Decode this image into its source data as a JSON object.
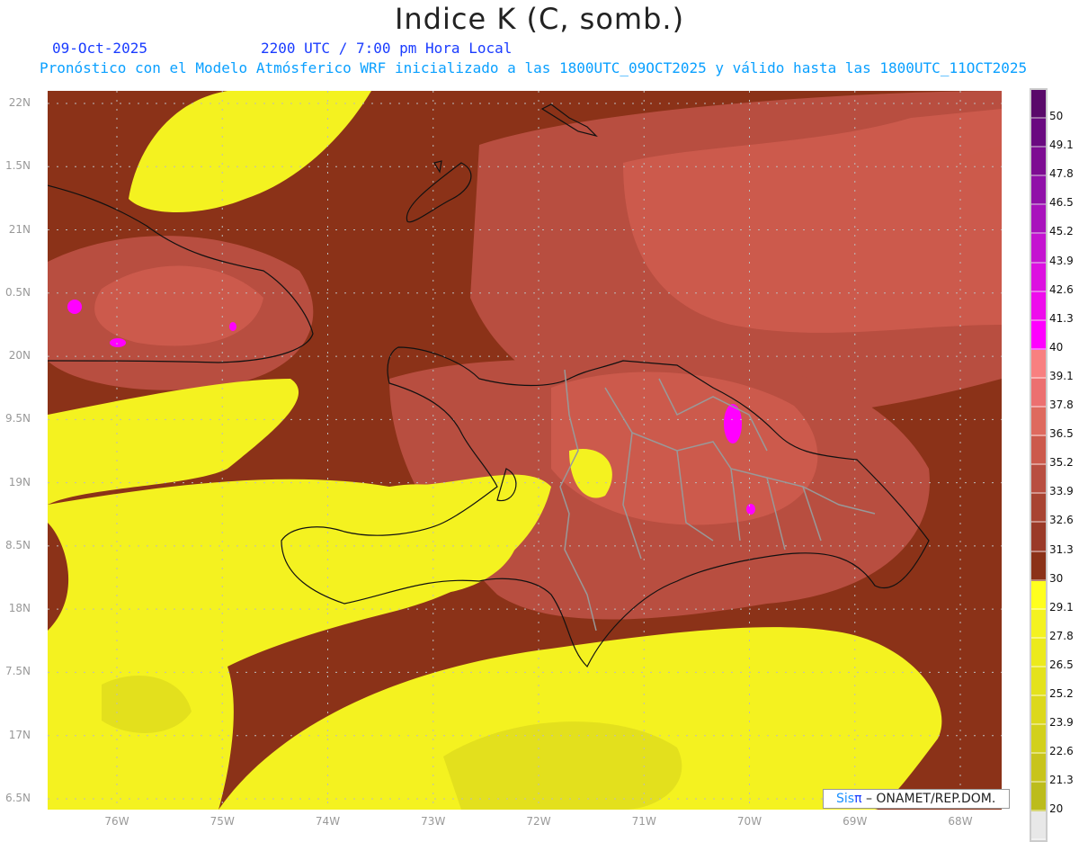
{
  "title": "Indice K (C, somb.)",
  "date": "09-Oct-2025",
  "time": "2200 UTC / 7:00 pm Hora Local",
  "info": "Pronóstico con el Modelo Atmósferico WRF inicializado a las 1800UTC_09OCT2025 y válido hasta las  1800UTC_11OCT2025",
  "credit": {
    "sis": "Sis",
    "pi": "π",
    "org": " – ONAMET/REP.DOM."
  },
  "axes": {
    "lon_labels": [
      "76W",
      "75W",
      "74W",
      "73W",
      "72W",
      "71W",
      "70W",
      "69W",
      "68W"
    ],
    "lon_values": [
      76,
      75,
      74,
      73,
      72,
      71,
      70,
      69,
      68
    ],
    "lat_labels": [
      "22N",
      "1.5N",
      "21N",
      "0.5N",
      "20N",
      "9.5N",
      "19N",
      "8.5N",
      "18N",
      "7.5N",
      "17N",
      "6.5N"
    ],
    "lat_values": [
      22,
      21.5,
      21,
      20.5,
      20,
      19.5,
      19,
      18.5,
      18,
      17.5,
      17,
      16.5
    ]
  },
  "colorbar": {
    "labels": [
      "50",
      "49.1",
      "47.8",
      "46.5",
      "45.2",
      "43.9",
      "42.6",
      "41.3",
      "40",
      "39.1",
      "37.8",
      "36.5",
      "35.2",
      "33.9",
      "32.6",
      "31.3",
      "30",
      "29.1",
      "27.8",
      "26.5",
      "25.2",
      "23.9",
      "22.6",
      "21.3",
      "20"
    ],
    "colors": [
      "#5a0a6a",
      "#6a0a80",
      "#7d0c92",
      "#9010a8",
      "#a812bc",
      "#c414d0",
      "#dc10e0",
      "#ee0cec",
      "#ff00ff",
      "#f88080",
      "#ec7070",
      "#de6a5e",
      "#cc5a4c",
      "#b84e40",
      "#a84432",
      "#9a3a28",
      "#8b3218",
      "#ffff1e",
      "#f4f220",
      "#ecea1c",
      "#e4e21c",
      "#dcd81c",
      "#d2d01c",
      "#c8c41c",
      "#bcbc1c",
      "#e8e8e8"
    ]
  }
}
